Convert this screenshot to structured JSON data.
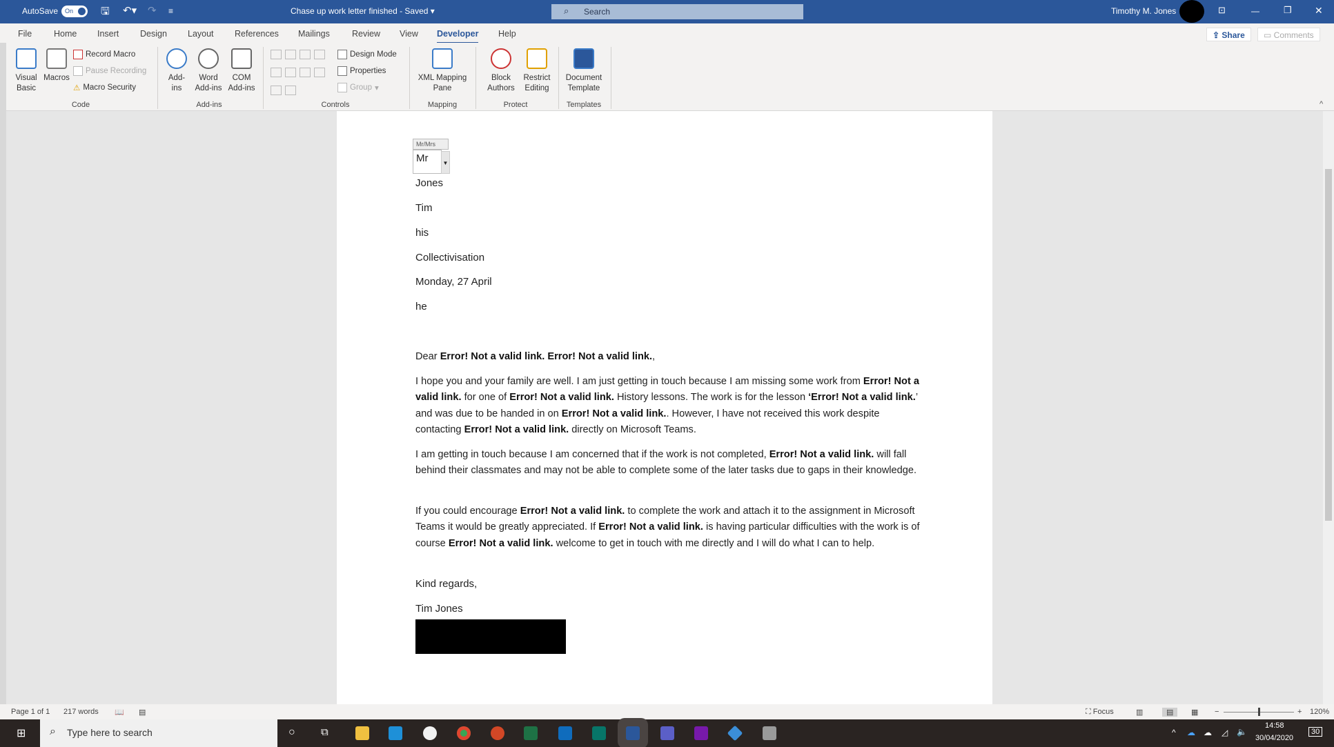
{
  "titlebar": {
    "autosave_label": "AutoSave",
    "autosave_state": "On",
    "doc_title": "Chase up work letter finished  -  Saved ▾",
    "search_placeholder": "Search",
    "user_name": "Timothy M. Jones",
    "colors": {
      "accent": "#2b579a"
    }
  },
  "tabs": [
    "File",
    "Home",
    "Insert",
    "Design",
    "Layout",
    "References",
    "Mailings",
    "Review",
    "View",
    "Developer",
    "Help"
  ],
  "active_tab": "Developer",
  "share_label": "Share",
  "comments_label": "Comments",
  "ribbon": {
    "code": {
      "label": "Code",
      "visual_basic": "Visual Basic",
      "macros": "Macros",
      "record_macro": "Record Macro",
      "pause_recording": "Pause Recording",
      "macro_security": "Macro Security"
    },
    "addins": {
      "label": "Add-ins",
      "addins": "Add-ins",
      "word_addins": "Word Add-ins",
      "com_addins": "COM Add-ins"
    },
    "controls": {
      "label": "Controls",
      "design_mode": "Design Mode",
      "properties": "Properties",
      "group": "Group"
    },
    "mapping": {
      "label": "Mapping",
      "xml_mapping_pane": "XML Mapping Pane"
    },
    "protect": {
      "label": "Protect",
      "block_authors": "Block Authors",
      "restrict_editing": "Restrict Editing"
    },
    "templates": {
      "label": "Templates",
      "document_template": "Document Template"
    }
  },
  "document": {
    "content_control": {
      "tag": "Mr/Mrs",
      "value": "Mr"
    },
    "lines": [
      "Jones",
      "Tim",
      "his",
      "Collectivisation",
      "Monday, 27 April",
      "he"
    ],
    "greeting": [
      {
        "t": "Dear "
      },
      {
        "t": "Error! Not a valid link. Error! Not a valid link.",
        "b": true
      },
      {
        "t": ","
      }
    ],
    "paragraphs": [
      [
        {
          "t": "I hope you and your family are well. I am just getting in touch because I am missing some work from "
        },
        {
          "t": "Error! Not a valid link.",
          "b": true
        },
        {
          "t": " for one of "
        },
        {
          "t": "Error! Not a valid link.",
          "b": true
        },
        {
          "t": " History lessons. The work is for the lesson "
        },
        {
          "t": "‘Error! Not a valid link.",
          "b": true
        },
        {
          "t": "’ and was due to be handed in on "
        },
        {
          "t": "Error! Not a valid link.",
          "b": true
        },
        {
          "t": ". However, I have not received this work despite contacting "
        },
        {
          "t": "Error! Not a valid link.",
          "b": true
        },
        {
          "t": " directly on Microsoft Teams."
        }
      ],
      [
        {
          "t": "I am getting in touch because I am concerned that if the work is not completed, "
        },
        {
          "t": "Error! Not a valid link.",
          "b": true
        },
        {
          "t": " will fall behind their classmates and may not be able to complete some of the later tasks due to gaps in their knowledge."
        }
      ],
      [
        {
          "t": "If you could encourage "
        },
        {
          "t": "Error! Not a valid link.",
          "b": true
        },
        {
          "t": " to complete the work and attach it to the assignment in Microsoft Teams it would be greatly appreciated. If "
        },
        {
          "t": "Error! Not a valid link.",
          "b": true
        },
        {
          "t": " is having particular difficulties with the work is of course "
        },
        {
          "t": "Error! Not a valid link.",
          "b": true
        },
        {
          "t": " welcome to get in touch with me directly and I will do what I can to help."
        }
      ]
    ],
    "closing": "Kind regards,",
    "signature": "Tim Jones"
  },
  "statusbar": {
    "page": "Page 1 of 1",
    "words": "217 words",
    "focus": "Focus",
    "zoom": "120%",
    "zoom_slider_percent": 120
  },
  "taskbar": {
    "search_placeholder": "Type here to search",
    "time": "14:58",
    "date": "30/04/2020",
    "notifications": "30"
  }
}
